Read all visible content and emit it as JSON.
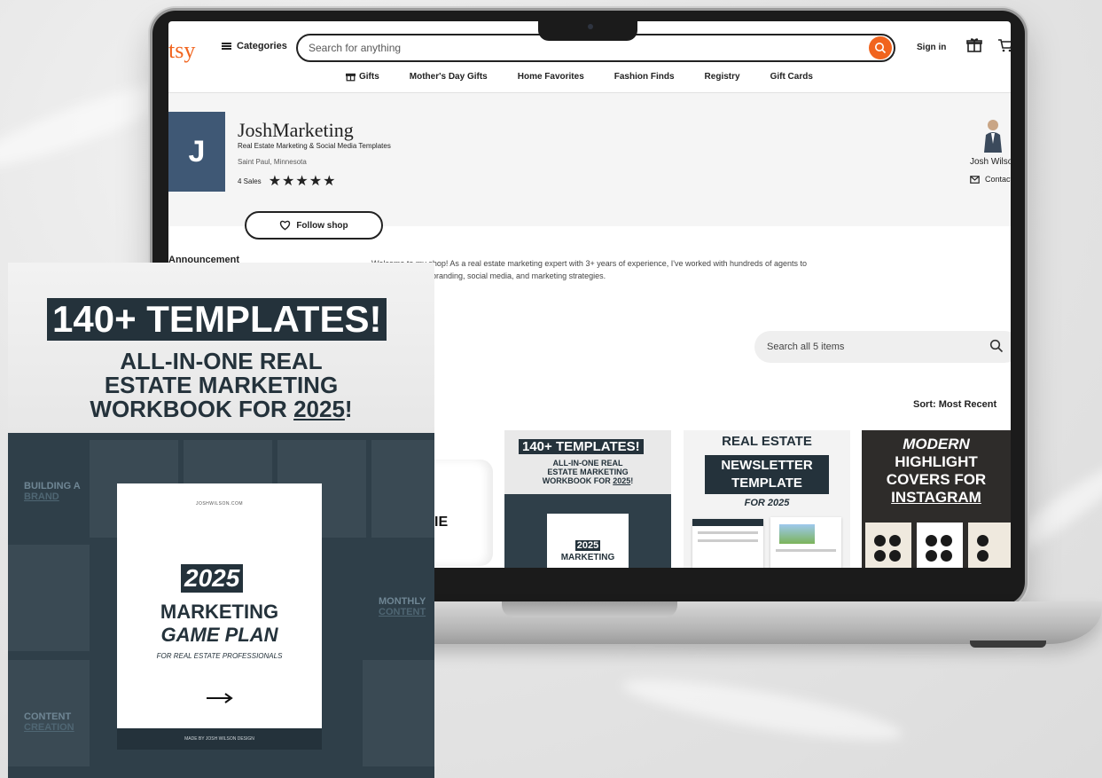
{
  "etsy": {
    "logo": "tsy",
    "categories_label": "Categories",
    "search_placeholder": "Search for anything",
    "signin_label": "Sign in",
    "nav": [
      "Gifts",
      "Mother's Day Gifts",
      "Home Favorites",
      "Fashion Finds",
      "Registry",
      "Gift Cards"
    ],
    "accent_color": "#f1641e"
  },
  "shop": {
    "avatar_letter": "J",
    "name": "JoshMarketing",
    "tagline": "Real Estate Marketing & Social Media Templates",
    "location": "Saint Paul, Minnesota",
    "sales": "4 Sales",
    "stars": "★★★★★",
    "follow_label": "Follow shop",
    "owner_name": "Josh Wilson",
    "contact_label": "Contact",
    "announcement_label": "Announcement",
    "welcome_line1": "Welcome to my shop! As a real estate marketing expert with 3+ years of experience, I've worked with hundreds of agents to",
    "welcome_line2": "branding, social media, and marketing strategies.",
    "items_search_placeholder": "Search all 5 items",
    "sort_label": "Sort: Most Recent"
  },
  "listings": {
    "mug_text": "IE",
    "t1_head": "140+ TEMPLATES!",
    "t1_sub_1": "ALL-IN-ONE REAL",
    "t1_sub_2": "ESTATE MARKETING",
    "t1_sub_3_prefix": "WORKBOOK FOR ",
    "t1_sub_3_year": "2025",
    "t1_sub_3_suffix": "!",
    "t1_card_year": "2025",
    "t1_card_word": "MARKETING",
    "t2_title": "REAL ESTATE",
    "t2_band_1": "NEWSLETTER",
    "t2_band_2": "TEMPLATE",
    "t2_year": "FOR 2025",
    "t3_line1": "MODERN",
    "t3_line2": "HIGHLIGHT",
    "t3_line3": "COVERS FOR",
    "t3_line4": "INSTAGRAM"
  },
  "poster": {
    "headline": "140+ TEMPLATES!",
    "sub_1": "ALL-IN-ONE REAL",
    "sub_2": "ESTATE MARKETING",
    "sub_3_prefix": "WORKBOOK FOR ",
    "sub_3_year": "2025",
    "sub_3_suffix": "!",
    "side_building_1": "BUILDING A",
    "side_building_2": "BRAND",
    "side_monthly_1": "MONTHLY",
    "side_monthly_2": "CONTENT",
    "side_content_1": "CONTENT",
    "side_content_2": "CREATION",
    "cover_site": "JOSHWILSON.COM",
    "cover_year": "2025",
    "cover_marketing": "MARKETING",
    "cover_game_plan": "GAME PLAN",
    "cover_for": "FOR REAL ESTATE PROFESSIONALS",
    "cover_footer": "MADE BY JOSH WILSON DESIGN",
    "brand_color": "#24323b"
  }
}
